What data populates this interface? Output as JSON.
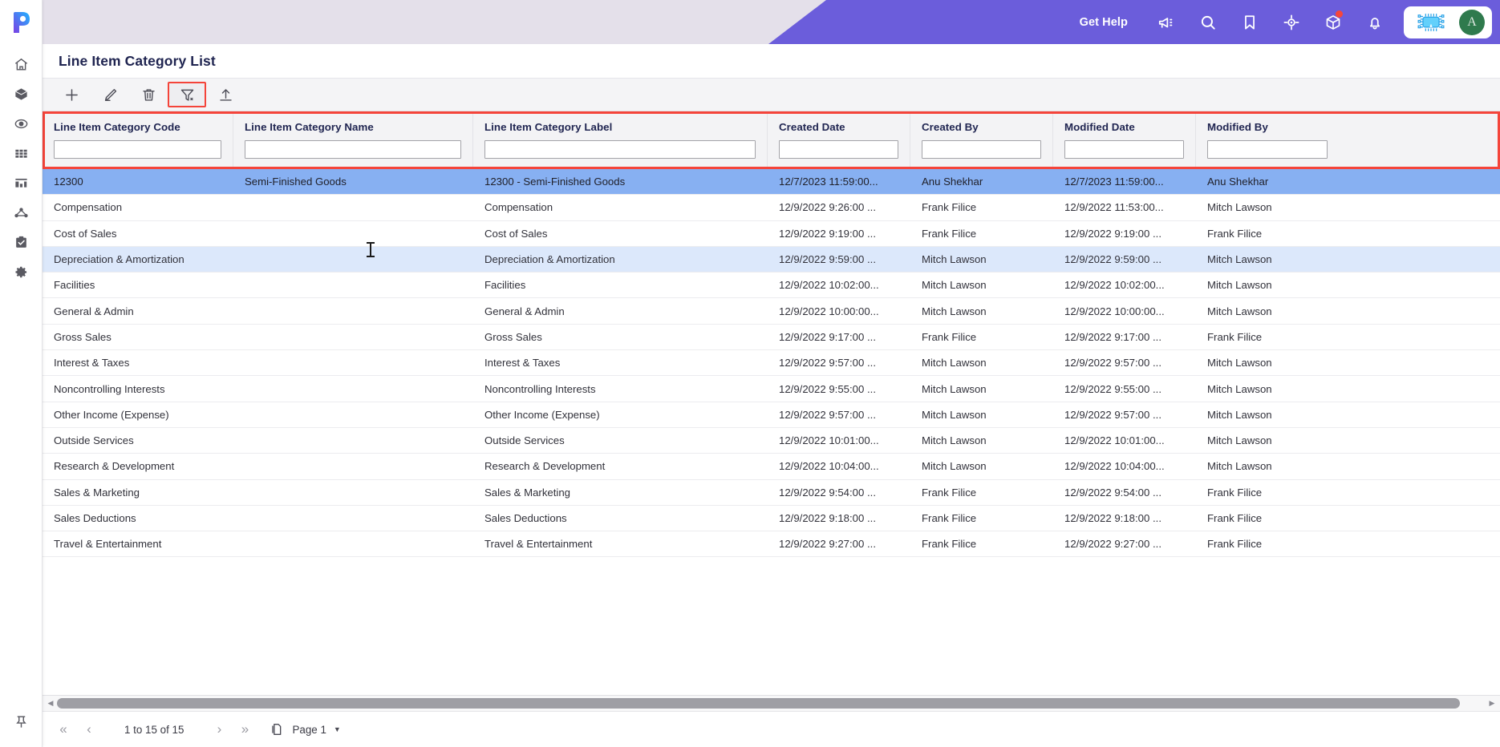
{
  "brand": {
    "accent_purple": "#6b5ddb",
    "topbar_lavender": "#e4e0ea",
    "highlight_red": "#f4443a",
    "row_selected_blue": "#87b0f2",
    "row_hover_blue": "#dce8fb",
    "avatar_green": "#2f7a4d"
  },
  "topbar": {
    "get_help_label": "Get Help",
    "icons": [
      {
        "name": "announcement-icon",
        "label": "Announcements"
      },
      {
        "name": "search-icon",
        "label": "Search"
      },
      {
        "name": "bookmark-icon",
        "label": "Bookmarks"
      },
      {
        "name": "target-icon",
        "label": "Focus"
      },
      {
        "name": "package-icon",
        "label": "Packages",
        "badge": true
      },
      {
        "name": "bell-icon",
        "label": "Notifications"
      }
    ],
    "ai_chip_icon": "ai-chip-icon",
    "avatar_initial": "A"
  },
  "sidebar": {
    "logo_icon": "pipeline-logo-icon",
    "items": [
      {
        "icon": "home-icon",
        "label": "Home"
      },
      {
        "icon": "cube-icon",
        "label": "Models"
      },
      {
        "icon": "target-dot-icon",
        "label": "Scenarios"
      },
      {
        "icon": "grid-icon",
        "label": "Grids"
      },
      {
        "icon": "bar-chart-icon",
        "label": "Reports"
      },
      {
        "icon": "hierarchy-icon",
        "label": "Hierarchy"
      },
      {
        "icon": "clipboard-check-icon",
        "label": "Tasks"
      },
      {
        "icon": "gear-icon",
        "label": "Settings"
      }
    ],
    "pin_icon": "pin-icon"
  },
  "page": {
    "title": "Line Item Category List"
  },
  "toolbar": {
    "buttons": [
      {
        "name": "add-button",
        "icon": "plus-icon",
        "label": "Add",
        "highlighted": false
      },
      {
        "name": "edit-button",
        "icon": "pencil-icon",
        "label": "Edit",
        "highlighted": false
      },
      {
        "name": "delete-button",
        "icon": "trash-icon",
        "label": "Delete",
        "highlighted": false
      },
      {
        "name": "clear-filter-button",
        "icon": "filter-clear-icon",
        "label": "Clear Filter",
        "highlighted": true
      },
      {
        "name": "export-button",
        "icon": "upload-icon",
        "label": "Export",
        "highlighted": false
      }
    ]
  },
  "grid": {
    "columns": [
      {
        "key": "code",
        "label": "Line Item Category Code",
        "filter_value": "",
        "filter_placeholder": ""
      },
      {
        "key": "name",
        "label": "Line Item Category Name",
        "filter_value": "",
        "filter_placeholder": ""
      },
      {
        "key": "label",
        "label": "Line Item Category Label",
        "filter_value": "",
        "filter_placeholder": ""
      },
      {
        "key": "created_date",
        "label": "Created Date",
        "filter_value": "",
        "filter_placeholder": ""
      },
      {
        "key": "created_by",
        "label": "Created By",
        "filter_value": "",
        "filter_placeholder": ""
      },
      {
        "key": "modified_date",
        "label": "Modified Date",
        "filter_value": "",
        "filter_placeholder": ""
      },
      {
        "key": "modified_by",
        "label": "Modified By",
        "filter_value": "",
        "filter_placeholder": ""
      }
    ],
    "rows": [
      {
        "state": "selected",
        "code": "12300",
        "name": "Semi-Finished Goods",
        "label": "12300 - Semi-Finished Goods",
        "created_date": "12/7/2023 11:59:00...",
        "created_by": "Anu Shekhar",
        "modified_date": "12/7/2023 11:59:00...",
        "modified_by": "Anu Shekhar"
      },
      {
        "state": "normal",
        "code": "Compensation",
        "name": "",
        "label": "Compensation",
        "created_date": "12/9/2022 9:26:00 ...",
        "created_by": "Frank Filice",
        "modified_date": "12/9/2022 11:53:00...",
        "modified_by": "Mitch Lawson"
      },
      {
        "state": "normal",
        "code": "Cost of Sales",
        "name": "",
        "label": "Cost of Sales",
        "created_date": "12/9/2022 9:19:00 ...",
        "created_by": "Frank Filice",
        "modified_date": "12/9/2022 9:19:00 ...",
        "modified_by": "Frank Filice"
      },
      {
        "state": "hovered",
        "code": "Depreciation & Amortization",
        "name": "",
        "label": "Depreciation & Amortization",
        "created_date": "12/9/2022 9:59:00 ...",
        "created_by": "Mitch Lawson",
        "modified_date": "12/9/2022 9:59:00 ...",
        "modified_by": "Mitch Lawson"
      },
      {
        "state": "normal",
        "code": "Facilities",
        "name": "",
        "label": "Facilities",
        "created_date": "12/9/2022 10:02:00...",
        "created_by": "Mitch Lawson",
        "modified_date": "12/9/2022 10:02:00...",
        "modified_by": "Mitch Lawson"
      },
      {
        "state": "normal",
        "code": "General & Admin",
        "name": "",
        "label": "General & Admin",
        "created_date": "12/9/2022 10:00:00...",
        "created_by": "Mitch Lawson",
        "modified_date": "12/9/2022 10:00:00...",
        "modified_by": "Mitch Lawson"
      },
      {
        "state": "normal",
        "code": "Gross Sales",
        "name": "",
        "label": "Gross Sales",
        "created_date": "12/9/2022 9:17:00 ...",
        "created_by": "Frank Filice",
        "modified_date": "12/9/2022 9:17:00 ...",
        "modified_by": "Frank Filice"
      },
      {
        "state": "normal",
        "code": "Interest & Taxes",
        "name": "",
        "label": "Interest & Taxes",
        "created_date": "12/9/2022 9:57:00 ...",
        "created_by": "Mitch Lawson",
        "modified_date": "12/9/2022 9:57:00 ...",
        "modified_by": "Mitch Lawson"
      },
      {
        "state": "normal",
        "code": "Noncontrolling Interests",
        "name": "",
        "label": "Noncontrolling Interests",
        "created_date": "12/9/2022 9:55:00 ...",
        "created_by": "Mitch Lawson",
        "modified_date": "12/9/2022 9:55:00 ...",
        "modified_by": "Mitch Lawson"
      },
      {
        "state": "normal",
        "code": "Other Income (Expense)",
        "name": "",
        "label": "Other Income (Expense)",
        "created_date": "12/9/2022 9:57:00 ...",
        "created_by": "Mitch Lawson",
        "modified_date": "12/9/2022 9:57:00 ...",
        "modified_by": "Mitch Lawson"
      },
      {
        "state": "normal",
        "code": "Outside Services",
        "name": "",
        "label": "Outside Services",
        "created_date": "12/9/2022 10:01:00...",
        "created_by": "Mitch Lawson",
        "modified_date": "12/9/2022 10:01:00...",
        "modified_by": "Mitch Lawson"
      },
      {
        "state": "normal",
        "code": "Research & Development",
        "name": "",
        "label": "Research & Development",
        "created_date": "12/9/2022 10:04:00...",
        "created_by": "Mitch Lawson",
        "modified_date": "12/9/2022 10:04:00...",
        "modified_by": "Mitch Lawson"
      },
      {
        "state": "normal",
        "code": "Sales & Marketing",
        "name": "",
        "label": "Sales & Marketing",
        "created_date": "12/9/2022 9:54:00 ...",
        "created_by": "Frank Filice",
        "modified_date": "12/9/2022 9:54:00 ...",
        "modified_by": "Frank Filice"
      },
      {
        "state": "normal",
        "code": "Sales Deductions",
        "name": "",
        "label": "Sales Deductions",
        "created_date": "12/9/2022 9:18:00 ...",
        "created_by": "Frank Filice",
        "modified_date": "12/9/2022 9:18:00 ...",
        "modified_by": "Frank Filice"
      },
      {
        "state": "normal",
        "code": "Travel & Entertainment",
        "name": "",
        "label": "Travel & Entertainment",
        "created_date": "12/9/2022 9:27:00 ...",
        "created_by": "Frank Filice",
        "modified_date": "12/9/2022 9:27:00 ...",
        "modified_by": "Frank Filice"
      }
    ]
  },
  "pager": {
    "first_label": "«",
    "prev_label": "‹",
    "range_label": "1 to 15 of 15",
    "next_label": "›",
    "last_label": "»",
    "pages_icon": "pages-icon",
    "page_label": "Page 1",
    "caret_icon": "chevron-down-icon"
  }
}
